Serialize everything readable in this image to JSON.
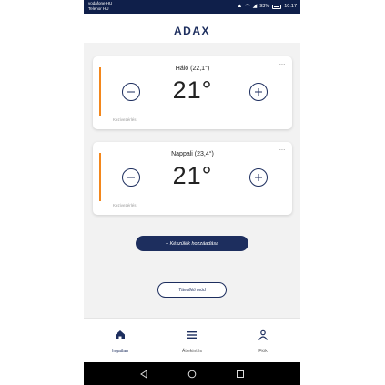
{
  "status_bar": {
    "carrier_line1": "vodafone HU",
    "carrier_line2": "Telenor HU",
    "battery": "93%",
    "time": "10:17"
  },
  "header": {
    "logo": "ADAX"
  },
  "devices": [
    {
      "name": "Háló (22,1°)",
      "setpoint": "21°",
      "mode": "Kézivezérlés"
    },
    {
      "name": "Nappali (23,4°)",
      "setpoint": "21°",
      "mode": "Kézivezérlés"
    }
  ],
  "card_menu_label": "···",
  "add_device_label": "+ Készülék hozzáadása",
  "away_mode_label": "Távolléti mód",
  "bottom_nav": [
    {
      "label": "Ingatlan",
      "icon": "home-icon",
      "active": true
    },
    {
      "label": "Áttekintés",
      "icon": "list-icon",
      "active": false
    },
    {
      "label": "Fiók",
      "icon": "person-icon",
      "active": false
    }
  ],
  "colors": {
    "brand": "#1d2e5e",
    "accent": "#f3871c",
    "status_bar": "#0f1f4a"
  }
}
